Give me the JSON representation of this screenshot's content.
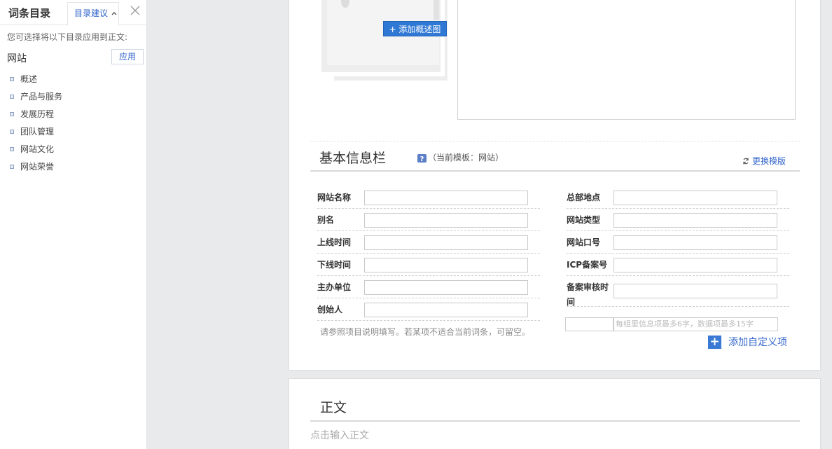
{
  "sidebar": {
    "title": "词条目录",
    "tab_label": "目录建议",
    "desc": "您可选择将以下目录应用到正文:",
    "site_label": "网站",
    "apply_label": "应用",
    "items": [
      "概述",
      "产品与服务",
      "发展历程",
      "团队管理",
      "网站文化",
      "网站荣誉"
    ]
  },
  "editor": {
    "add_image_label": "+ 添加概述图",
    "section_title": "基本信息栏",
    "template_note": "（当前模板：网站）",
    "switch_template": "更换模版",
    "left_fields": [
      "网站名称",
      "别名",
      "上线时间",
      "下线时间",
      "主办单位",
      "创始人"
    ],
    "right_fields": [
      "总部地点",
      "网站类型",
      "网站口号",
      "ICP备案号",
      "备案审核时间"
    ],
    "hint": "请参照项目说明填写。若某项不适合当前词条，可留空。",
    "custom_placeholder": "每组里信息项最多6字，数据项最多15字",
    "add_custom": "添加自定义项",
    "body_title": "正文",
    "body_placeholder": "点击输入正文"
  },
  "colors": {
    "accent": "#3366cc",
    "button_blue": "#2f78d4"
  }
}
